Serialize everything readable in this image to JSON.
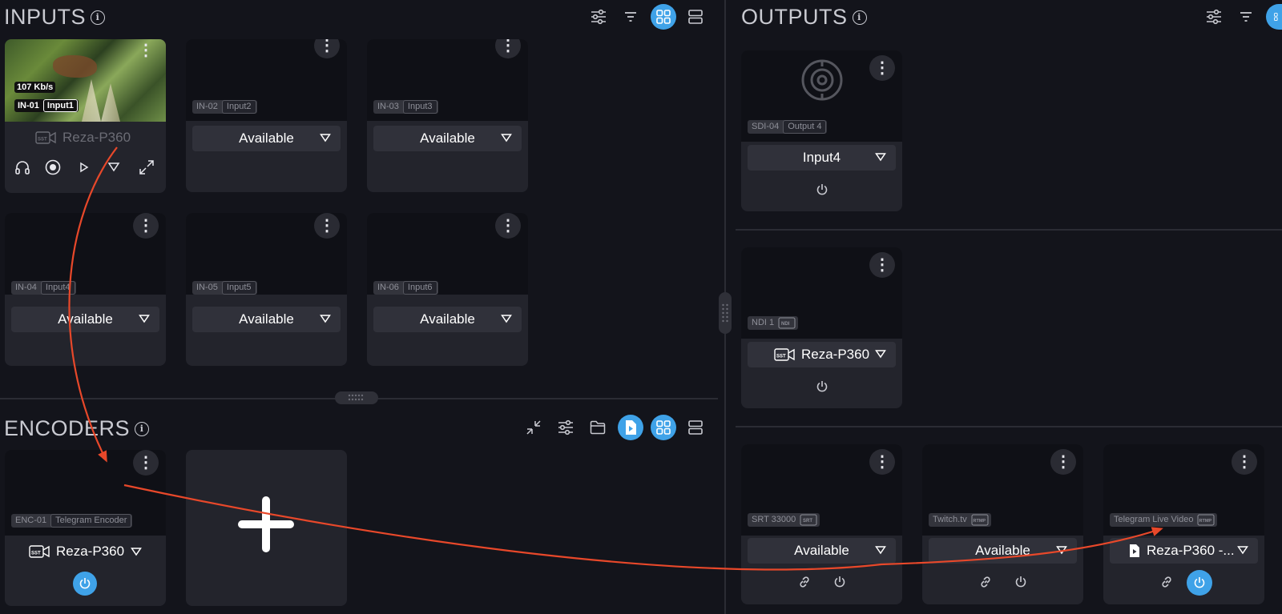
{
  "inputs": {
    "title": "INPUTS",
    "cards": [
      {
        "id": "IN-01",
        "name": "Input1",
        "bitrate": "107 Kb/s",
        "source": "Reza-P360"
      },
      {
        "id": "IN-02",
        "name": "Input2",
        "status": "Available"
      },
      {
        "id": "IN-03",
        "name": "Input3",
        "status": "Available"
      },
      {
        "id": "IN-04",
        "name": "Input4",
        "status": "Available"
      },
      {
        "id": "IN-05",
        "name": "Input5",
        "status": "Available"
      },
      {
        "id": "IN-06",
        "name": "Input6",
        "status": "Available"
      }
    ]
  },
  "encoders": {
    "title": "ENCODERS",
    "card": {
      "id": "ENC-01",
      "name": "Telegram Encoder",
      "source": "Reza-P360"
    }
  },
  "outputs": {
    "title": "OUTPUTS",
    "sdi": {
      "id": "SDI-04",
      "name": "Output 4",
      "source": "Input4"
    },
    "ndi": {
      "id": "NDI 1",
      "source": "Reza-P360"
    },
    "streams": [
      {
        "name": "SRT 33000",
        "status": "Available"
      },
      {
        "name": "Twitch.tv",
        "status": "Available"
      },
      {
        "name": "Telegram Live Video",
        "source": "Reza-P360 -..."
      }
    ]
  },
  "icons": {
    "info": "i",
    "kebab": "⋮"
  },
  "colors": {
    "accent": "#3fa2e8",
    "arrow": "#e8482a",
    "background": "#13141b",
    "card": "#23242c"
  }
}
